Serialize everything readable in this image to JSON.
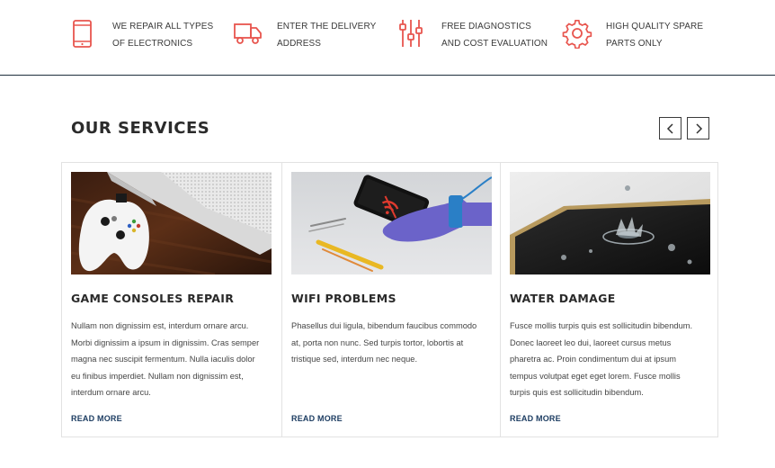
{
  "features": [
    {
      "icon": "smartphone-icon",
      "lines": [
        "WE REPAIR ALL TYPES",
        "OF ELECTRONICS"
      ]
    },
    {
      "icon": "delivery-truck-icon",
      "lines": [
        "ENTER THE DELIVERY",
        "ADDRESS"
      ]
    },
    {
      "icon": "sliders-icon",
      "lines": [
        "FREE DIAGNOSTICS",
        "AND COST EVALUATION"
      ]
    },
    {
      "icon": "gear-icon",
      "lines": [
        "HIGH QUALITY SPARE",
        "PARTS ONLY"
      ]
    }
  ],
  "services": {
    "title": "OUR SERVICES",
    "prev_icon": "chevron-left-icon",
    "next_icon": "chevron-right-icon",
    "cards": [
      {
        "title": "GAME CONSOLES REPAIR",
        "image": "game-console-photo",
        "text": [
          "Nullam non dignissim est, interdum ornare arcu.",
          "Morbi dignissim a ipsum in dignissim. Cras semper",
          "magna nec suscipit fermentum. Nulla iaculis dolor",
          "eu finibus imperdiet. Nullam non dignissim est,",
          "interdum ornare arcu."
        ],
        "link": "READ MORE"
      },
      {
        "title": "WIFI PROBLEMS",
        "image": "phone-wifi-repair-photo",
        "text": [
          "Phasellus dui ligula, bibendum faucibus commodo",
          "at, porta non nunc. Sed turpis tortor, lobortis at",
          "tristique sed, interdum nec neque."
        ],
        "link": "READ MORE"
      },
      {
        "title": "WATER DAMAGE",
        "image": "water-splash-device-photo",
        "text": [
          "Fusce mollis turpis quis est sollicitudin bibendum.",
          "Donec laoreet leo dui, laoreet cursus metus",
          "pharetra ac. Proin condimentum dui at ipsum",
          "tempus volutpat eget eget lorem. Fusce mollis",
          "turpis quis est sollicitudin bibendum."
        ],
        "link": "READ MORE"
      }
    ]
  },
  "colors": {
    "accent": "#e8554e",
    "link": "#1d3d62",
    "divider": "#1f2f3d"
  }
}
